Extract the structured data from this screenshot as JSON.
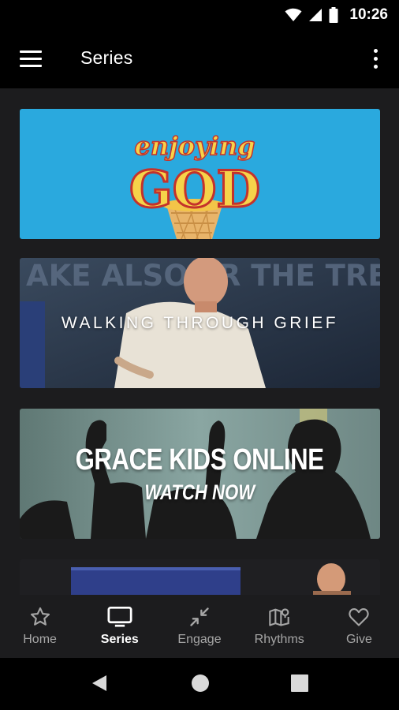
{
  "status": {
    "time": "10:26"
  },
  "appbar": {
    "title": "Series"
  },
  "cards": [
    {
      "line1": "enjoying",
      "line2": "GOD"
    },
    {
      "title": "WALKING THROUGH GRIEF",
      "bg_text": "AKE ALSO FR   THE TREE"
    },
    {
      "title": "GRACE KIDS ONLINE",
      "subtitle": "WATCH NOW"
    }
  ],
  "nav": [
    {
      "label": "Home",
      "icon": "star-icon"
    },
    {
      "label": "Series",
      "icon": "tv-icon",
      "active": true
    },
    {
      "label": "Engage",
      "icon": "collapse-arrows-icon"
    },
    {
      "label": "Rhythms",
      "icon": "map-pin-icon"
    },
    {
      "label": "Give",
      "icon": "heart-icon"
    }
  ],
  "colors": {
    "accent": "#ffffff",
    "inactive": "#a6a6a6",
    "card1_bg": "#2aa9de"
  }
}
